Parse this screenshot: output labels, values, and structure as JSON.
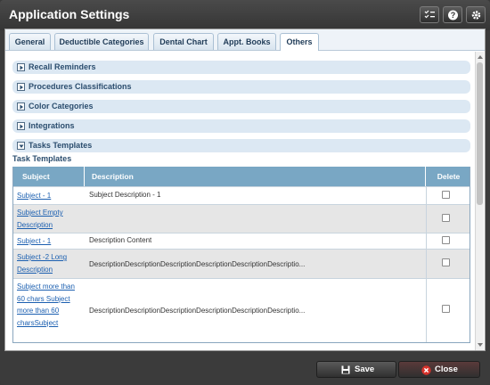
{
  "window": {
    "title": "Application Settings"
  },
  "tabs": [
    {
      "label": "General"
    },
    {
      "label": "Deductible Categories"
    },
    {
      "label": "Dental Chart"
    },
    {
      "label": "Appt. Books"
    },
    {
      "label": "Others"
    }
  ],
  "sections": [
    {
      "label": "Recall Reminders"
    },
    {
      "label": "Procedures Classifications"
    },
    {
      "label": "Color Categories"
    },
    {
      "label": "Integrations"
    },
    {
      "label": "Tasks Templates"
    }
  ],
  "task_templates": {
    "title": "Task Templates",
    "columns": {
      "subject": "Subject",
      "description": "Description",
      "delete": "Delete"
    },
    "rows": [
      {
        "subject": "Subject - 1",
        "description": "Subject Description - 1"
      },
      {
        "subject": "Subject Empty Description",
        "description": ""
      },
      {
        "subject": "Subject - 1",
        "description": "Description Content"
      },
      {
        "subject": "Subject -2 Long Description",
        "description": "DescriptionDescriptionDescriptionDescriptionDescriptionDescriptio..."
      },
      {
        "subject": "Subject more than 60 chars Subject more than 60 charsSubject",
        "description": "DescriptionDescriptionDescriptionDescriptionDescriptionDescriptio..."
      }
    ]
  },
  "footer": {
    "save_label": "Save",
    "close_label": "Close"
  },
  "colors": {
    "header_bg": "#79a7c4",
    "section_bg": "#dce8f3",
    "link": "#1b5fb0"
  }
}
